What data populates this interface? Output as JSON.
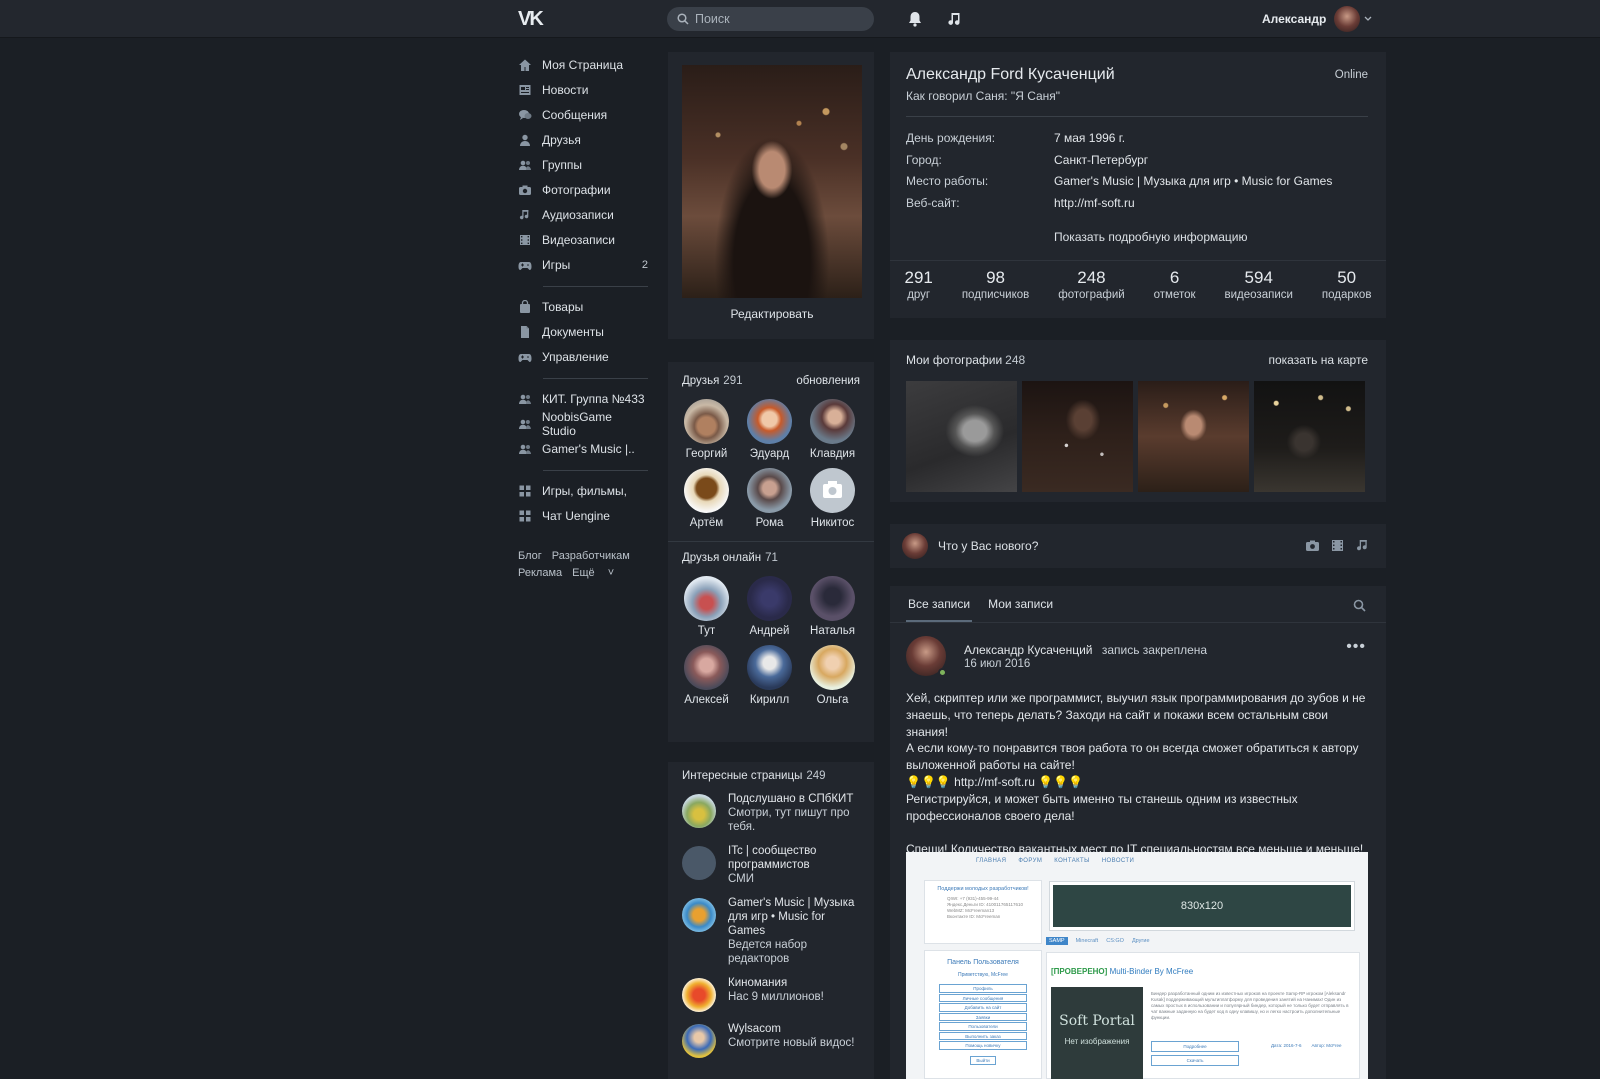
{
  "header": {
    "logo": "VK",
    "search_placeholder": "Поиск",
    "user_name": "Александр"
  },
  "sidebar": {
    "items": [
      {
        "label": "Моя Страница",
        "icon": "home-icon"
      },
      {
        "label": "Новости",
        "icon": "news-icon"
      },
      {
        "label": "Сообщения",
        "icon": "messages-icon"
      },
      {
        "label": "Друзья",
        "icon": "friends-icon"
      },
      {
        "label": "Группы",
        "icon": "groups-icon"
      },
      {
        "label": "Фотографии",
        "icon": "camera-icon"
      },
      {
        "label": "Аудиозаписи",
        "icon": "music-icon"
      },
      {
        "label": "Видеозаписи",
        "icon": "video-icon"
      },
      {
        "label": "Игры",
        "icon": "gamepad-icon",
        "count": "2"
      }
    ],
    "items2": [
      {
        "label": "Товары",
        "icon": "bag-icon"
      },
      {
        "label": "Документы",
        "icon": "document-icon"
      },
      {
        "label": "Управление",
        "icon": "gamepad-icon"
      }
    ],
    "items3": [
      {
        "label": "КИТ. Группа №433",
        "icon": "groups-icon"
      },
      {
        "label": "NoobisGame Studio",
        "icon": "groups-icon"
      },
      {
        "label": "Gamer's Music |..",
        "icon": "groups-icon"
      }
    ],
    "items4": [
      {
        "label": "Игры, фильмы,",
        "icon": "apps-icon"
      },
      {
        "label": "Чат Uengine",
        "icon": "apps-icon"
      }
    ],
    "footer": {
      "blog": "Блог",
      "dev": "Разработчикам",
      "ads": "Реклама",
      "more": "Ещё"
    }
  },
  "profile_photo": {
    "edit_label": "Редактировать"
  },
  "friends": {
    "title": "Друзья",
    "count": "291",
    "updates": "обновления",
    "list": [
      "Георгий",
      "Эдуард",
      "Клавдия",
      "Артём",
      "Рома",
      "Никитос"
    ],
    "online_title": "Друзья онлайн",
    "online_count": "71",
    "online_list": [
      "Тут",
      "Андрей",
      "Наталья",
      "Алексей",
      "Кирилл",
      "Ольга"
    ]
  },
  "pages": {
    "title": "Интересные страницы",
    "count": "249",
    "list": [
      {
        "name": "Подслушано в СПбКИТ",
        "sub": "Смотри, тут пишут про тебя."
      },
      {
        "name": "ITc | сообщество программистов",
        "sub": "СМИ"
      },
      {
        "name": "Gamer's Music | Музыка для игр • Music for Games",
        "sub": "Ведется набор редакторов"
      },
      {
        "name": "Киномания",
        "sub": "Нас 9 миллионов!"
      },
      {
        "name": "Wylsacom",
        "sub": "Смотрите новый видос!"
      }
    ]
  },
  "profile": {
    "name": "Александр Ford Кусаченций",
    "status": "Как говорил Саня: \"Я Саня\"",
    "online": "Online",
    "rows": [
      {
        "label": "День рождения:",
        "value": "7 мая 1996 г."
      },
      {
        "label": "Город:",
        "value": "Санкт-Петербург"
      },
      {
        "label": "Место работы:",
        "value": "Gamer's Music | Музыка для игр • Music for Games"
      },
      {
        "label": "Веб-сайт:",
        "value": "http://mf-soft.ru"
      }
    ],
    "more": "Показать подробную информацию",
    "stats": [
      {
        "num": "291",
        "label": "друг"
      },
      {
        "num": "98",
        "label": "подписчиков"
      },
      {
        "num": "248",
        "label": "фотографий"
      },
      {
        "num": "6",
        "label": "отметок"
      },
      {
        "num": "594",
        "label": "видеозаписи"
      },
      {
        "num": "50",
        "label": "подарков"
      }
    ]
  },
  "photos": {
    "title": "Мои фотографии",
    "count": "248",
    "map": "показать на карте"
  },
  "composer": {
    "placeholder": "Что у Вас нового?"
  },
  "wall": {
    "tab_all": "Все записи",
    "tab_mine": "Мои записи",
    "post": {
      "author": "Александр Кусаченций",
      "pinned": "запись закреплена",
      "date": "16 июл 2016",
      "lines": [
        "Хей, скриптер или же программист, выучил язык программирования до зубов и не",
        "знаешь, что теперь делать? Заходи на сайт и покажи всем остальным свои знания!",
        "А если кому-то понравится твоя работа то он всегда сможет обратиться к автору",
        "выложенной работы на сайте!"
      ],
      "link": "http://mf-soft.ru",
      "lines2": [
        "Регистрируйся, и может быть именно ты станешь одним из известных",
        "профессионалов своего дела!"
      ],
      "last": "Спеши! Количество вакантных мест по IT специальностям все меньше и меньше!"
    },
    "image": {
      "nav": [
        "ГЛАВНАЯ",
        "ФОРУМ",
        "КОНТАКТЫ",
        "НОВОСТИ"
      ],
      "box1_title": "Поддержи молодых разработчиков!",
      "box1_lines": [
        "QIWI: +7 (931)-455-99-44",
        "Яндекс.Деньги ID: 410011765117610",
        "WebMZ: McFreeman13",
        "Вконтакте ID: McFreeman"
      ],
      "panel_title": "Панель Пользователя",
      "panel_greet": "Приветствую, McFree",
      "panel_rows": [
        "Профиль",
        "Личные сообщения",
        "Добавить на сайт",
        "Заявки",
        "Пользователи",
        "Выполнить заказ",
        "Помощь новичку"
      ],
      "panel_btn": "Выйти",
      "banner": "830x120",
      "tabs": [
        "SAMP",
        "Minecraft",
        "CS:GO",
        "Другие"
      ],
      "article_prefix": "[ПРОВЕРЕНО]",
      "article_title": "Multi-Binder By McFree",
      "thumb_logo": "Soft Portal",
      "thumb_text": "Нет изображения",
      "desc": "Биндер разработанный одним из известных игроков на проекте Samp-RP игроком [Aleksandr Kusak] поддерживающий мультиплатформу для проведения занятий на Нанимах! Один из самых простых в использовании и популярный биндер, который не только будет отправлять в чат важные заданную на будет код в одну клавишу, но и легко настроить дополнительные функции.",
      "fields": [
        "Подробнее",
        "Скачать"
      ],
      "meta": [
        "Дата: 2016-7-6",
        "Автор: McFree"
      ]
    }
  }
}
